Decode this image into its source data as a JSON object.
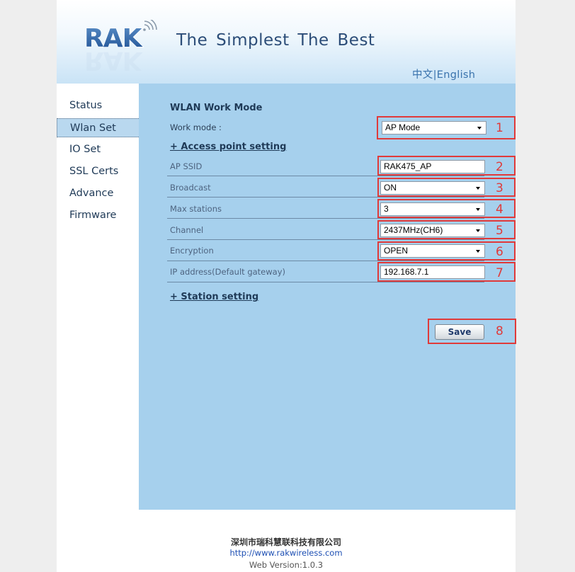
{
  "header": {
    "logo_text": "RAK",
    "tagline": "The  Simplest  The  Best",
    "lang_chinese": "中文",
    "lang_sep": "|",
    "lang_english": "English"
  },
  "sidebar": {
    "items": [
      {
        "label": "Status",
        "active": false
      },
      {
        "label": "Wlan Set",
        "active": true
      },
      {
        "label": "IO Set",
        "active": false
      },
      {
        "label": "SSL Certs",
        "active": false
      },
      {
        "label": "Advance",
        "active": false
      },
      {
        "label": "Firmware",
        "active": false
      }
    ]
  },
  "main": {
    "section_title": "WLAN Work Mode",
    "work_mode": {
      "label": "Work mode :",
      "value": "AP Mode",
      "marker": "1"
    },
    "ap_setting_link": "+ Access point setting",
    "ap_ssid": {
      "label": "AP SSID",
      "value": "RAK475_AP",
      "marker": "2"
    },
    "broadcast": {
      "label": "Broadcast",
      "value": "ON",
      "marker": "3"
    },
    "max_stations": {
      "label": "Max stations",
      "value": "3",
      "marker": "4"
    },
    "channel": {
      "label": "Channel",
      "value": "2437MHz(CH6)",
      "marker": "5"
    },
    "encryption": {
      "label": "Encryption",
      "value": "OPEN",
      "marker": "6"
    },
    "ip_address": {
      "label": "IP address(Default gateway)",
      "value": "192.168.7.1",
      "marker": "7"
    },
    "station_setting_link": "+ Station setting",
    "save_label": "Save",
    "save_marker": "8"
  },
  "footer": {
    "company": "深圳市瑞科慧联科技有限公司",
    "url": "http://www.rakwireless.com",
    "version": "Web Version:1.0.3"
  },
  "colors": {
    "accent_red": "#e03a3a",
    "panel_blue": "#a6d0ed",
    "active_tab": "#b9d8ef"
  }
}
